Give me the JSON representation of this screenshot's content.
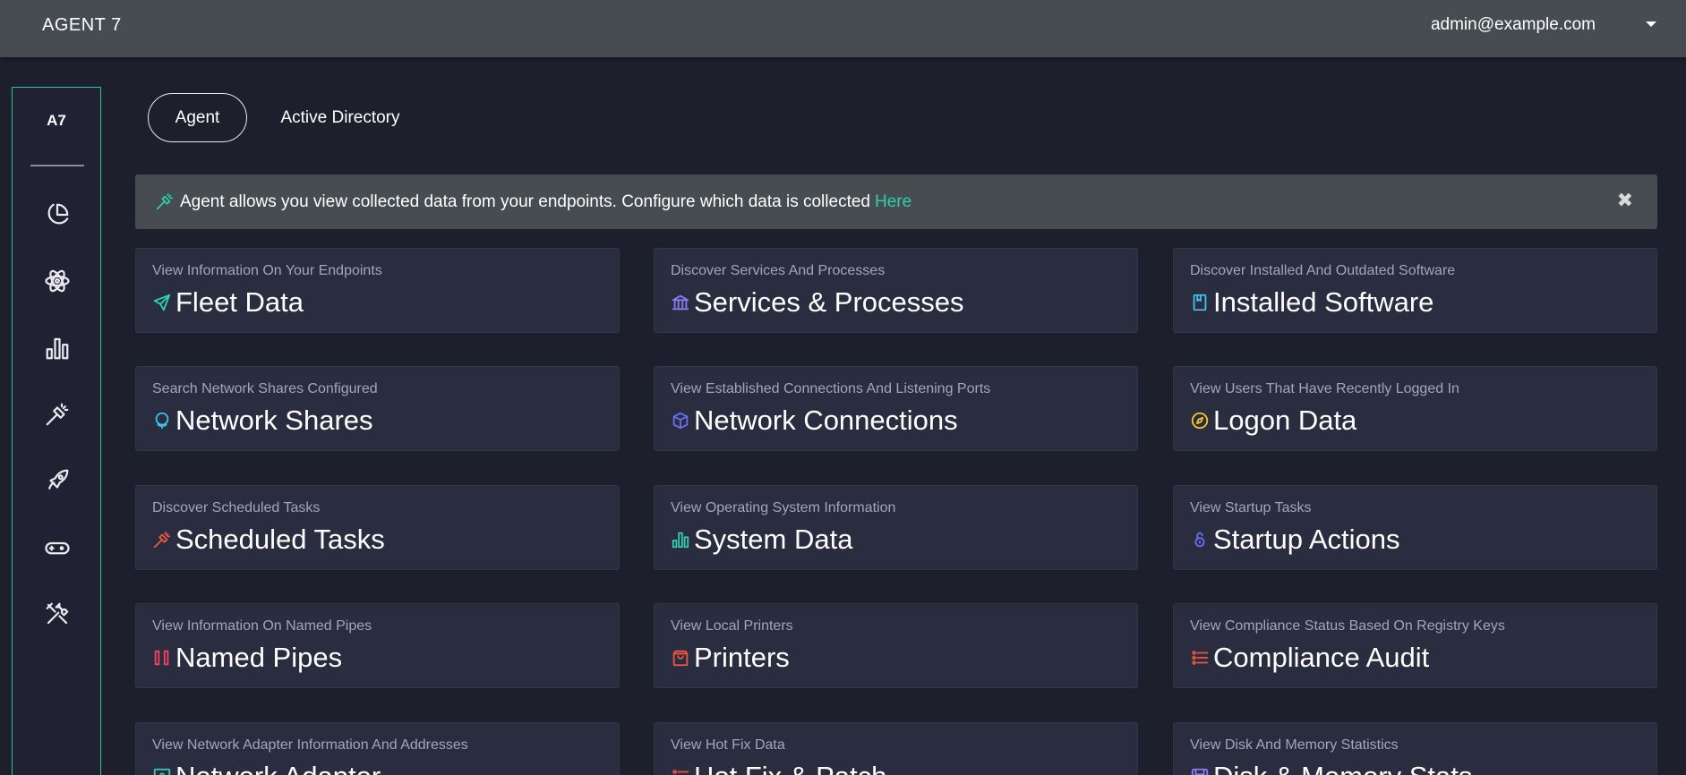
{
  "header": {
    "brand": "AGENT 7",
    "user_email": "admin@example.com",
    "menu_icon": "chevron-down-icon"
  },
  "sidebar": {
    "logo": "A7",
    "items": [
      {
        "icon": "pie-chart-icon"
      },
      {
        "icon": "atom-icon"
      },
      {
        "icon": "bar-chart-icon"
      },
      {
        "icon": "flashlight-icon"
      },
      {
        "icon": "rocket-icon"
      },
      {
        "icon": "gamepad-icon"
      },
      {
        "icon": "tools-icon"
      }
    ]
  },
  "tabs": [
    {
      "label": "Agent",
      "active": true
    },
    {
      "label": "Active Directory",
      "active": false
    }
  ],
  "banner": {
    "icon": "flashlight-icon",
    "text": "Agent allows you view collected data from your endpoints. Configure which data is collected",
    "link_text": "Here",
    "close": "✖"
  },
  "cards": [
    {
      "subtitle": "View Information On Your Endpoints",
      "title": "Fleet Data",
      "icon": "send-icon",
      "color": "#2ecfae"
    },
    {
      "subtitle": "Discover Services And Processes",
      "title": "Services & Processes",
      "icon": "bank-icon",
      "color": "#8b7cf6"
    },
    {
      "subtitle": "Discover Installed And Outdated Software",
      "title": "Installed Software",
      "icon": "book-icon",
      "color": "#3ec3e6"
    },
    {
      "subtitle": "Search Network Shares Configured",
      "title": "Network Shares",
      "icon": "globe-icon",
      "color": "#3ec3e6"
    },
    {
      "subtitle": "View Established Connections And Listening Ports",
      "title": "Network Connections",
      "icon": "cube-icon",
      "color": "#6b6cf3"
    },
    {
      "subtitle": "View Users That Have Recently Logged In",
      "title": "Logon Data",
      "icon": "compass-icon",
      "color": "#f3c623"
    },
    {
      "subtitle": "Discover Scheduled Tasks",
      "title": "Scheduled Tasks",
      "icon": "flashlight-icon",
      "color": "#f0563c"
    },
    {
      "subtitle": "View Operating System Information",
      "title": "System Data",
      "icon": "bar-chart-icon",
      "color": "#2ecfae"
    },
    {
      "subtitle": "View Startup Tasks",
      "title": "Startup Actions",
      "icon": "lock-icon",
      "color": "#6b6cf3"
    },
    {
      "subtitle": "View Information On Named Pipes",
      "title": "Named Pipes",
      "icon": "pipes-icon",
      "color": "#f2455f"
    },
    {
      "subtitle": "View Local Printers",
      "title": "Printers",
      "icon": "bag-icon",
      "color": "#f0563c"
    },
    {
      "subtitle": "View Compliance Status Based On Registry Keys",
      "title": "Compliance Audit",
      "icon": "list-icon",
      "color": "#f0563c"
    },
    {
      "subtitle": "View Network Adapter Information And Addresses",
      "title": "Network Adapter",
      "icon": "adapter-icon",
      "color": "#2ecfae"
    },
    {
      "subtitle": "View Hot Fix Data",
      "title": "Hot Fix & Patch",
      "icon": "list-icon",
      "color": "#f0563c"
    },
    {
      "subtitle": "View Disk And Memory Statistics",
      "title": "Disk & Memory Stats",
      "icon": "disk-icon",
      "color": "#8b7cf6"
    }
  ]
}
